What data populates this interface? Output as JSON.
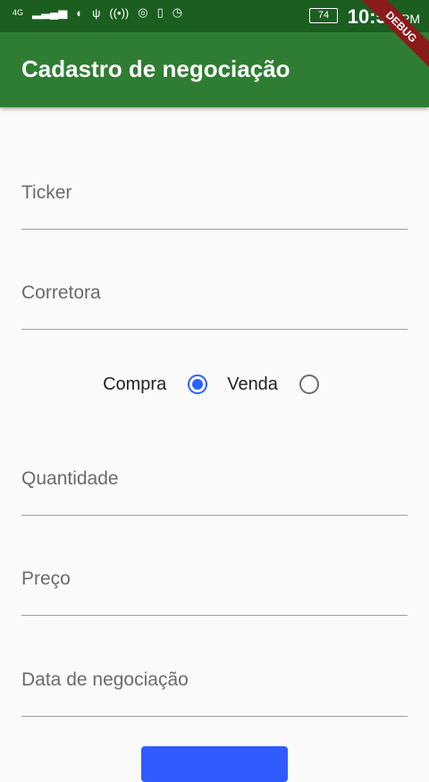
{
  "status_bar": {
    "network": "4G",
    "battery": "74",
    "time": "10:57",
    "ampm": "PM"
  },
  "app_bar": {
    "title": "Cadastro de negociação"
  },
  "debug_banner": "DEBUG",
  "form": {
    "fields": [
      {
        "label": "Ticker"
      },
      {
        "label": "Corretora"
      },
      {
        "label": "Quantidade"
      },
      {
        "label": "Preço"
      },
      {
        "label": "Data de negociação"
      }
    ],
    "radio": {
      "compra": "Compra",
      "venda": "Venda",
      "selected": "Compra"
    }
  },
  "colors": {
    "app_bar": "#2f7d32",
    "status_bar": "#1b5e20",
    "accent": "#2962ff"
  }
}
